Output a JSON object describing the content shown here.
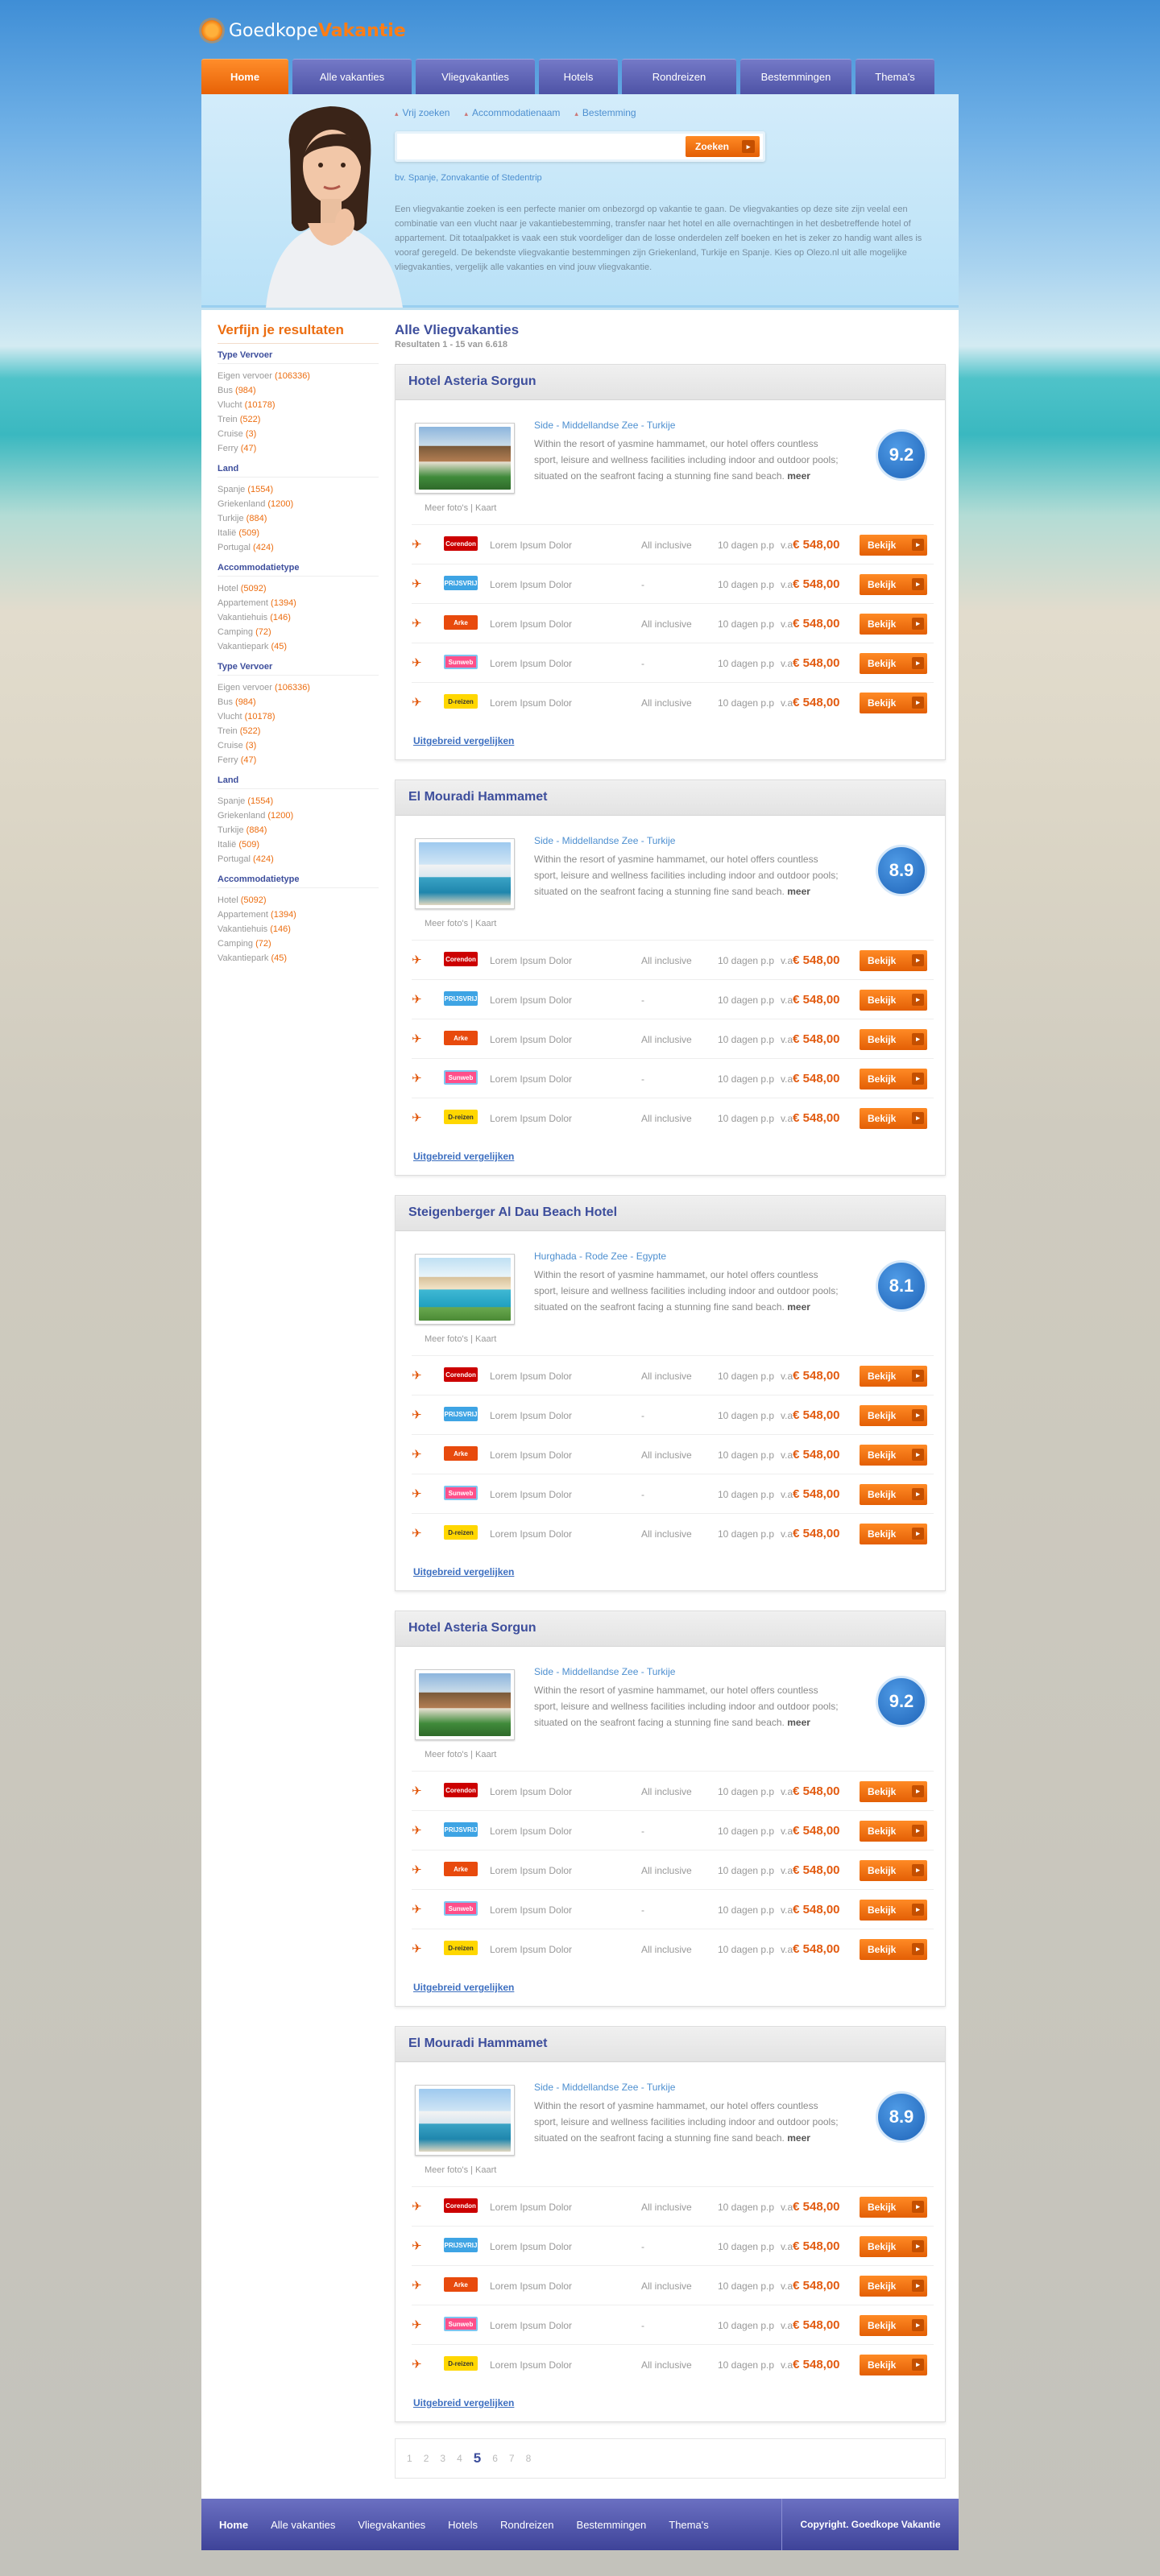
{
  "brand": {
    "name1": "Goedkope",
    "name2": "Vakantie"
  },
  "nav": [
    "Home",
    "Alle vakanties",
    "Vliegvakanties",
    "Hotels",
    "Rondreizen",
    "Bestemmingen",
    "Thema's"
  ],
  "search": {
    "tabs": [
      "Vrij zoeken",
      "Accommodatienaam",
      "Bestemming"
    ],
    "button": "Zoeken",
    "hint": "bv. Spanje, Zonvakantie of Stedentrip",
    "placeholder": ""
  },
  "intro": "Een vliegvakantie zoeken is een perfecte manier om onbezorgd op vakantie te gaan. De vliegvakanties op deze site zijn veelal een combinatie van een vlucht naar je vakantiebestemming, transfer naar het hotel en alle overnachtingen in het desbetreffende hotel of appartement. Dit totaalpakket is vaak een stuk voordeliger dan de losse onderdelen zelf boeken en het is zeker zo handig want alles is vooraf geregeld. De bekendste vliegvakantie bestemmingen zijn Griekenland, Turkije en Spanje. Kies op Olezo.nl uit alle mogelijke vliegvakanties, vergelijk alle vakanties en vind jouw vliegvakantie.",
  "sidebar": {
    "title": "Verfijn je resultaten",
    "groups": [
      {
        "title": "Type Vervoer",
        "items": [
          [
            "Eigen vervoer",
            "(106336)"
          ],
          [
            "Bus",
            "(984)"
          ],
          [
            "Vlucht",
            "(10178)"
          ],
          [
            "Trein",
            "(522)"
          ],
          [
            "Cruise",
            "(3)"
          ],
          [
            "Ferry",
            "(47)"
          ]
        ]
      },
      {
        "title": "Land",
        "items": [
          [
            "Spanje",
            "(1554)"
          ],
          [
            "Griekenland",
            "(1200)"
          ],
          [
            "Turkije",
            "(884)"
          ],
          [
            "Italië",
            "(509)"
          ],
          [
            "Portugal",
            "(424)"
          ]
        ]
      },
      {
        "title": "Accommodatietype",
        "items": [
          [
            "Hotel",
            "(5092)"
          ],
          [
            "Appartement",
            "(1394)"
          ],
          [
            "Vakantiehuis",
            "(146)"
          ],
          [
            "Camping",
            "(72)"
          ],
          [
            "Vakantiepark",
            "(45)"
          ]
        ]
      },
      {
        "title": "Type Vervoer",
        "items": [
          [
            "Eigen vervoer",
            "(106336)"
          ],
          [
            "Bus",
            "(984)"
          ],
          [
            "Vlucht",
            "(10178)"
          ],
          [
            "Trein",
            "(522)"
          ],
          [
            "Cruise",
            "(3)"
          ],
          [
            "Ferry",
            "(47)"
          ]
        ]
      },
      {
        "title": "Land",
        "items": [
          [
            "Spanje",
            "(1554)"
          ],
          [
            "Griekenland",
            "(1200)"
          ],
          [
            "Turkije",
            "(884)"
          ],
          [
            "Italië",
            "(509)"
          ],
          [
            "Portugal",
            "(424)"
          ]
        ]
      },
      {
        "title": "Accommodatietype",
        "items": [
          [
            "Hotel",
            "(5092)"
          ],
          [
            "Appartement",
            "(1394)"
          ],
          [
            "Vakantiehuis",
            "(146)"
          ],
          [
            "Camping",
            "(72)"
          ],
          [
            "Vakantiepark",
            "(45)"
          ]
        ]
      }
    ]
  },
  "results": {
    "title": "Alle Vliegvakanties",
    "count": "Resultaten 1 - 15 van 6.618"
  },
  "hotels": [
    {
      "name": "Hotel Asteria Sorgun",
      "loc": "Side - Middellandse Zee - Turkije",
      "score": "9.2",
      "img": "a"
    },
    {
      "name": "El Mouradi Hammamet",
      "loc": "Side - Middellandse Zee - Turkije",
      "score": "8.9",
      "img": "b"
    },
    {
      "name": "Steigenberger Al Dau Beach Hotel",
      "loc": "Hurghada - Rode Zee - Egypte",
      "score": "8.1",
      "img": "c"
    },
    {
      "name": "Hotel Asteria Sorgun",
      "loc": "Side - Middellandse Zee - Turkije",
      "score": "9.2",
      "img": "a"
    },
    {
      "name": "El Mouradi Hammamet",
      "loc": "Side - Middellandse Zee - Turkije",
      "score": "8.9",
      "img": "b"
    }
  ],
  "hotel_desc": "Within the resort of yasmine hammamet, our hotel offers countless sport, leisure and wellness facilities including indoor and outdoor pools; situated on the seafront facing a stunning fine sand beach.",
  "more_link": "meer",
  "photo_links": "Meer foto's | Kaart",
  "offers": [
    {
      "brand": "Corendon",
      "cls": "b1",
      "title": "Lorem Ipsum Dolor",
      "board": "All inclusive",
      "days": "10 dagen p.p",
      "from": "v.a",
      "price": "€ 548,00",
      "btn": "Bekijk"
    },
    {
      "brand": "PRIJSVRIJ",
      "cls": "b2",
      "title": "Lorem Ipsum Dolor",
      "board": "-",
      "days": "10 dagen p.p",
      "from": "v.a",
      "price": "€ 548,00",
      "btn": "Bekijk"
    },
    {
      "brand": "Arke",
      "cls": "b3",
      "title": "Lorem Ipsum Dolor",
      "board": "All inclusive",
      "days": "10 dagen p.p",
      "from": "v.a",
      "price": "€ 548,00",
      "btn": "Bekijk"
    },
    {
      "brand": "Sunweb",
      "cls": "b4",
      "title": "Lorem Ipsum Dolor",
      "board": "-",
      "days": "10 dagen p.p",
      "from": "v.a",
      "price": "€ 548,00",
      "btn": "Bekijk"
    },
    {
      "brand": "D-reizen",
      "cls": "b5",
      "title": "Lorem Ipsum Dolor",
      "board": "All inclusive",
      "days": "10 dagen p.p",
      "from": "v.a",
      "price": "€ 548,00",
      "btn": "Bekijk"
    }
  ],
  "compare": "Uitgebreid vergelijken",
  "pager": [
    "1",
    "2",
    "3",
    "4",
    "5",
    "6",
    "7",
    "8"
  ],
  "pager_current": "5",
  "footer": {
    "links": [
      "Home",
      "Alle vakanties",
      "Vliegvakanties",
      "Hotels",
      "Rondreizen",
      "Bestemmingen",
      "Thema's"
    ],
    "copy": "Copyright. Goedkope Vakantie"
  }
}
